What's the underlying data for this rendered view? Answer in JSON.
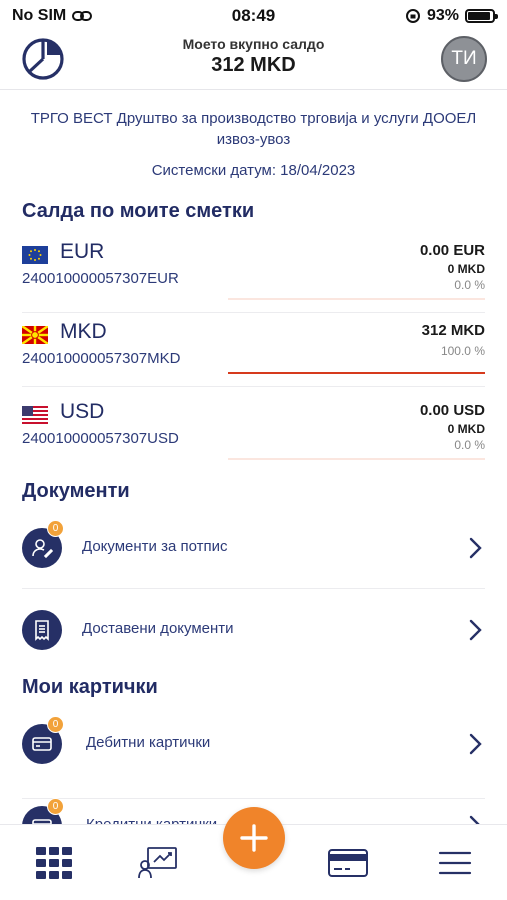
{
  "status_bar": {
    "carrier": "No SIM",
    "time": "08:49",
    "battery": "93%",
    "battery_level": 0.93
  },
  "header": {
    "subtitle": "Моето вкупно салдо",
    "balance": "312 MKD",
    "avatar_initials": "ТИ",
    "logo_icon": "pie-chart-icon"
  },
  "company": {
    "name": "ТРГО ВЕСТ Друштво за производство  трговија и услуги ДООЕЛ извоз-увоз"
  },
  "system_date": "Системски датум: 18/04/2023",
  "accounts_section": {
    "title": "Салда по моите сметки",
    "accounts": [
      {
        "currency": "EUR",
        "number": "240010000057307EUR",
        "amount": "0.00 EUR",
        "amount_mkd": "0 MKD",
        "percent": "0.0 %",
        "share": 0.0,
        "flag_icon": "eu-flag-icon"
      },
      {
        "currency": "MKD",
        "number": "240010000057307MKD",
        "amount": "312 MKD",
        "amount_mkd": "",
        "percent": "100.0 %",
        "share": 1.0,
        "flag_icon": "mk-flag-icon"
      },
      {
        "currency": "USD",
        "number": "240010000057307USD",
        "amount": "0.00 USD",
        "amount_mkd": "0 MKD",
        "percent": "0.0 %",
        "share": 0.0,
        "flag_icon": "us-flag-icon"
      }
    ]
  },
  "documents_section": {
    "title": "Документи",
    "items": [
      {
        "label": "Документи за потпис",
        "badge": "0",
        "icon": "sign-document-icon"
      },
      {
        "label": "Доставени документи",
        "badge": "",
        "icon": "delivered-document-icon"
      }
    ]
  },
  "cards_section": {
    "title": "Мои картички",
    "items": [
      {
        "label": "Дебитни картички",
        "badge": "0",
        "icon": "debit-card-icon"
      },
      {
        "label": "Кредитни картички",
        "badge": "0",
        "icon": "credit-card-icon"
      }
    ]
  },
  "tab_bar": {
    "items": [
      "grid-menu-icon",
      "presentation-icon",
      "add-icon",
      "card-icon",
      "hamburger-menu-icon"
    ]
  },
  "colors": {
    "primary": "#263066",
    "accent": "#f0842a",
    "bar": "#d63a1d",
    "badge": "#f2a23a"
  }
}
